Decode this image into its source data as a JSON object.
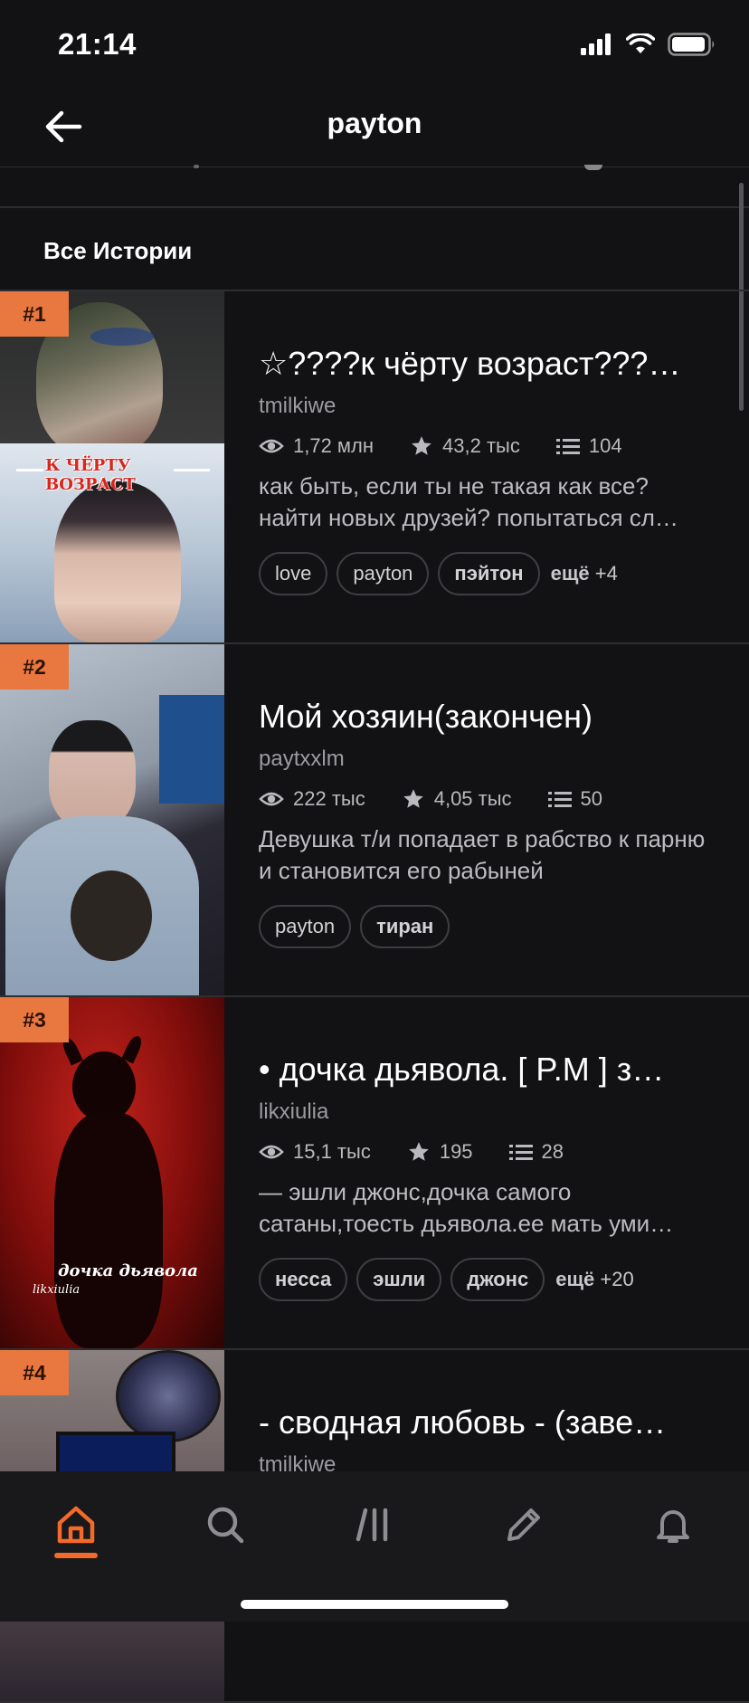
{
  "status": {
    "time": "21:14"
  },
  "nav": {
    "title": "payton"
  },
  "section": {
    "title": "Все Истории"
  },
  "stories": [
    {
      "rank": "#1",
      "title": "☆????к чёрту возраст???…",
      "author": "tmilkiwe",
      "views": "1,72 млн",
      "votes": "43,2 тыс",
      "parts": "104",
      "description": "как быть, если ты не такая как все? найти новых друзей? попытаться сл…",
      "tags": [
        "love",
        "payton",
        "пэйтон"
      ],
      "more_label": "ещё",
      "more_count": "+4",
      "cover_text": "К ЧЁРТУ ВОЗРАСТ"
    },
    {
      "rank": "#2",
      "title": "Мой хозяин(закончен)",
      "author": "paytxxlm",
      "views": "222 тыс",
      "votes": "4,05 тыс",
      "parts": "50",
      "description": "Девушка т/и попадает в рабство к парню и становится его рабыней",
      "tags": [
        "payton",
        "тиран"
      ]
    },
    {
      "rank": "#3",
      "title": "• дочка дьявола. [ P.M ]  з…",
      "author": "likxiulia",
      "views": "15,1 тыс",
      "votes": "195",
      "parts": "28",
      "description": "— эшли джонс,дочка самого сатаны,тоесть дьявола.ее мать уми…",
      "tags": [
        "несса",
        "эшли",
        "джонс"
      ],
      "more_label": "ещё",
      "more_count": "+20",
      "cover_text": "дочка дьявола",
      "cover_subtext": "likxiulia"
    },
    {
      "rank": "#4",
      "title": "- сводная любовь - (заве…",
      "author": "tmilkiwe"
    }
  ],
  "tabs": [
    "home",
    "search",
    "library",
    "write",
    "notifications"
  ],
  "colors": {
    "accent": "#f46a2a",
    "badge": "#e8783f",
    "background": "#121113"
  }
}
